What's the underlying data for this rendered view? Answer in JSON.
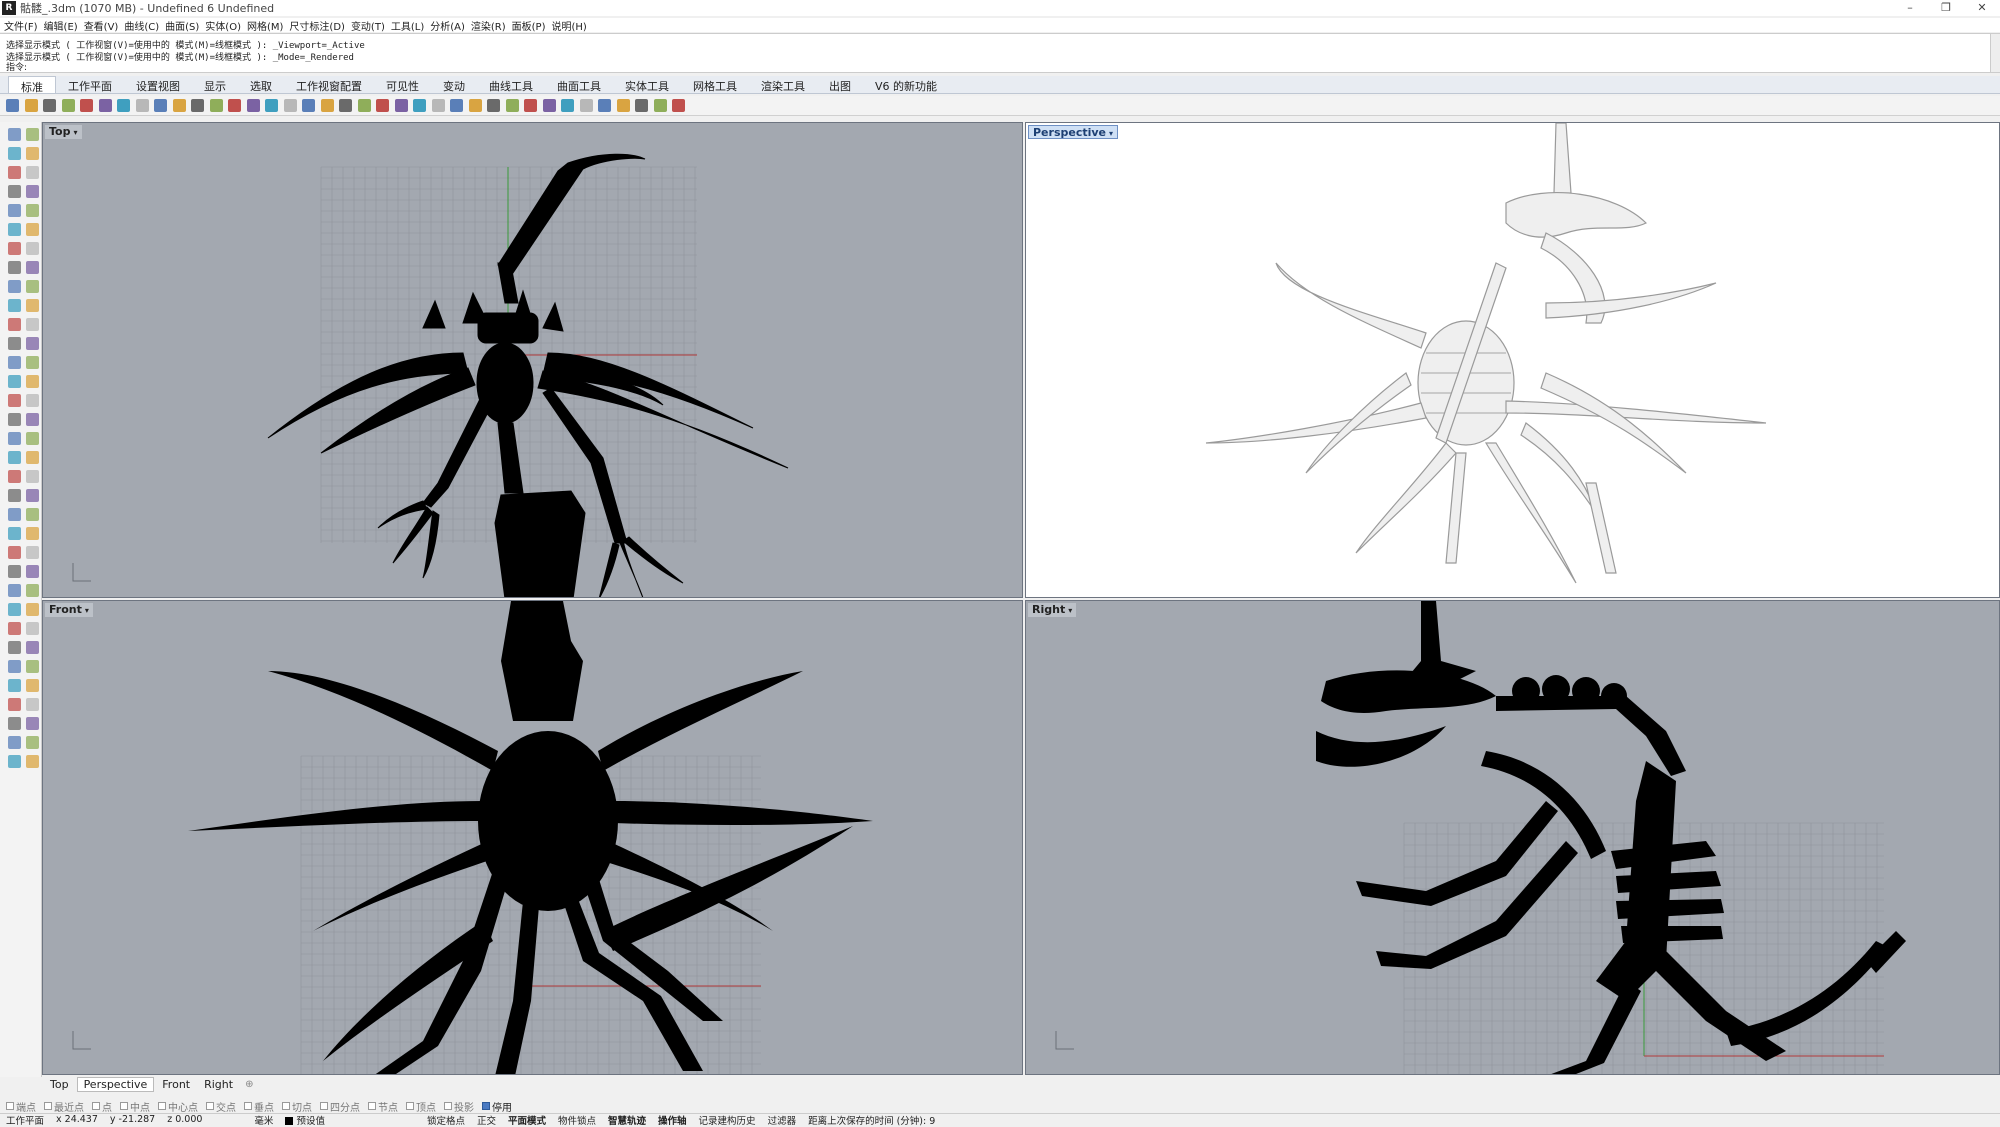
{
  "titlebar": {
    "title": "骷髅_.3dm (1070 MB) - Undefined 6 Undefined",
    "logo_icon": "rhino-logo-icon",
    "minimize": "–",
    "maximize": "❐",
    "close": "✕"
  },
  "menu": [
    "文件(F)",
    "编辑(E)",
    "查看(V)",
    "曲线(C)",
    "曲面(S)",
    "实体(O)",
    "网格(M)",
    "尺寸标注(D)",
    "变动(T)",
    "工具(L)",
    "分析(A)",
    "渲染(R)",
    "面板(P)",
    "说明(H)"
  ],
  "command_history": [
    "选择显示模式 ( 工作视窗(V)=使用中的  模式(M)=线框模式 ): _Viewport=_Active",
    "选择显示模式 ( 工作视窗(V)=使用中的  模式(M)=线框模式 ): _Mode=_Rendered"
  ],
  "command_prompt": "指令:",
  "tabs": [
    "标准",
    "工作平面",
    "设置视图",
    "显示",
    "选取",
    "工作视窗配置",
    "可见性",
    "变动",
    "曲线工具",
    "曲面工具",
    "实体工具",
    "网格工具",
    "渲染工具",
    "出图",
    "V6 的新功能"
  ],
  "active_tab": "标准",
  "toolbar_icon_count": 37,
  "viewports": {
    "top": {
      "label": "Top"
    },
    "perspective": {
      "label": "Perspective"
    },
    "front": {
      "label": "Front"
    },
    "right": {
      "label": "Right"
    }
  },
  "view_tabs": [
    "Top",
    "Perspective",
    "Front",
    "Right"
  ],
  "active_view_tab": "Perspective",
  "add_view_tab": "⊕",
  "osnaps": [
    {
      "label": "端点",
      "on": false
    },
    {
      "label": "最近点",
      "on": false
    },
    {
      "label": "点",
      "on": false
    },
    {
      "label": "中点",
      "on": false
    },
    {
      "label": "中心点",
      "on": false
    },
    {
      "label": "交点",
      "on": false
    },
    {
      "label": "垂点",
      "on": false
    },
    {
      "label": "切点",
      "on": false
    },
    {
      "label": "四分点",
      "on": false
    },
    {
      "label": "节点",
      "on": false
    },
    {
      "label": "顶点",
      "on": false
    },
    {
      "label": "投影",
      "on": false
    },
    {
      "label": "停用",
      "on": true
    }
  ],
  "status": {
    "cplane": "工作平面",
    "x": "x 24.437",
    "y": "y -21.287",
    "z": "z 0.000",
    "units": "毫米",
    "layer": "预设值",
    "grid_snap": "锁定格点",
    "ortho": "正交",
    "planar": "平面模式",
    "object_snap": "物件锁点",
    "smart_track": "智慧轨迹",
    "gumball": "操作轴",
    "history": "记录建构历史",
    "filter": "过滤器",
    "autosave": "距离上次保存的时间 (分钟): 9"
  },
  "colors": {
    "viewport_bg": "#a3a8b0",
    "perspective_bg": "#ffffff",
    "silhouette": "#000000",
    "grid_line": "#8f949c",
    "x_axis": "#b03a3a",
    "y_axis": "#3a9a3a"
  }
}
